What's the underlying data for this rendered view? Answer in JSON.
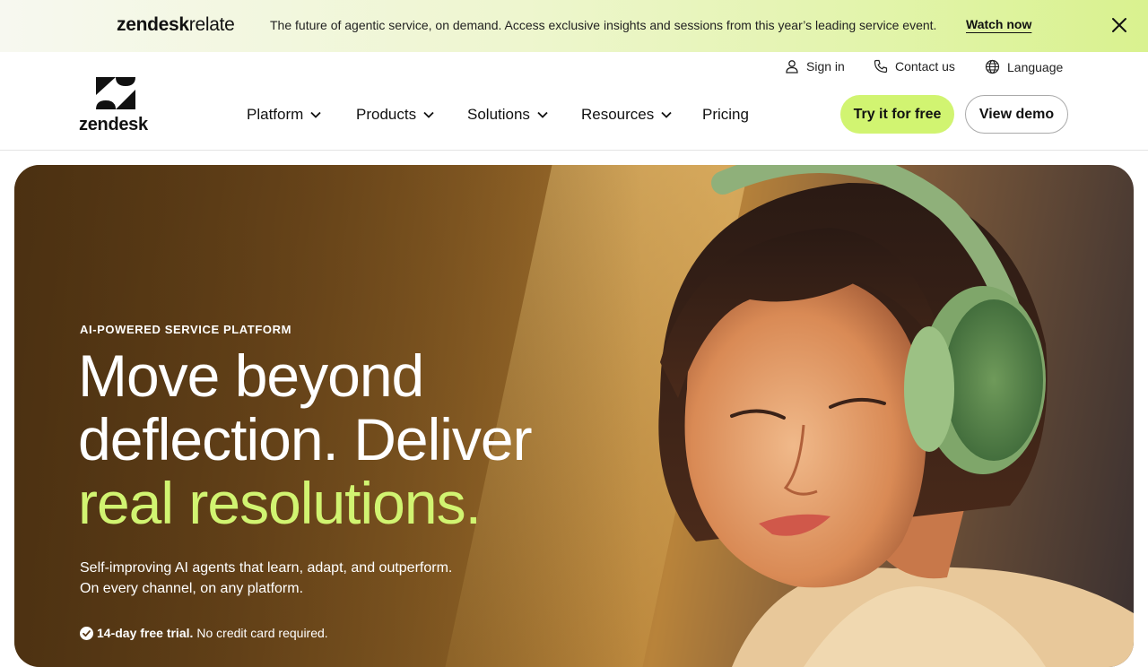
{
  "banner": {
    "brand_bold": "zendesk",
    "brand_light": "relate",
    "message": "The future of agentic service, on demand. Access exclusive insights and sessions from this year’s leading service event.",
    "watch_label": "Watch now",
    "close_icon": "close-icon"
  },
  "header": {
    "logo_text": "zendesk",
    "utility": {
      "signin": "Sign in",
      "contact": "Contact us",
      "language": "Language"
    },
    "nav": [
      {
        "label": "Platform"
      },
      {
        "label": "Products"
      },
      {
        "label": "Solutions"
      },
      {
        "label": "Resources"
      },
      {
        "label": "Pricing"
      }
    ],
    "cta_try": "Try it for free",
    "cta_demo": "View demo"
  },
  "hero": {
    "eyebrow": "AI-POWERED SERVICE PLATFORM",
    "headline_line1": "Move beyond",
    "headline_line2": "deflection. Deliver",
    "headline_accent": "real resolutions.",
    "sub_line1": "Self-improving AI agents that learn, adapt, and outperform.",
    "sub_line2": "On every channel, on any platform.",
    "trial_bold": "14-day free trial.",
    "trial_rest": "No credit card required."
  },
  "colors": {
    "accent": "#d1f471",
    "text": "#111111",
    "hero_brown": "#7a5020"
  }
}
